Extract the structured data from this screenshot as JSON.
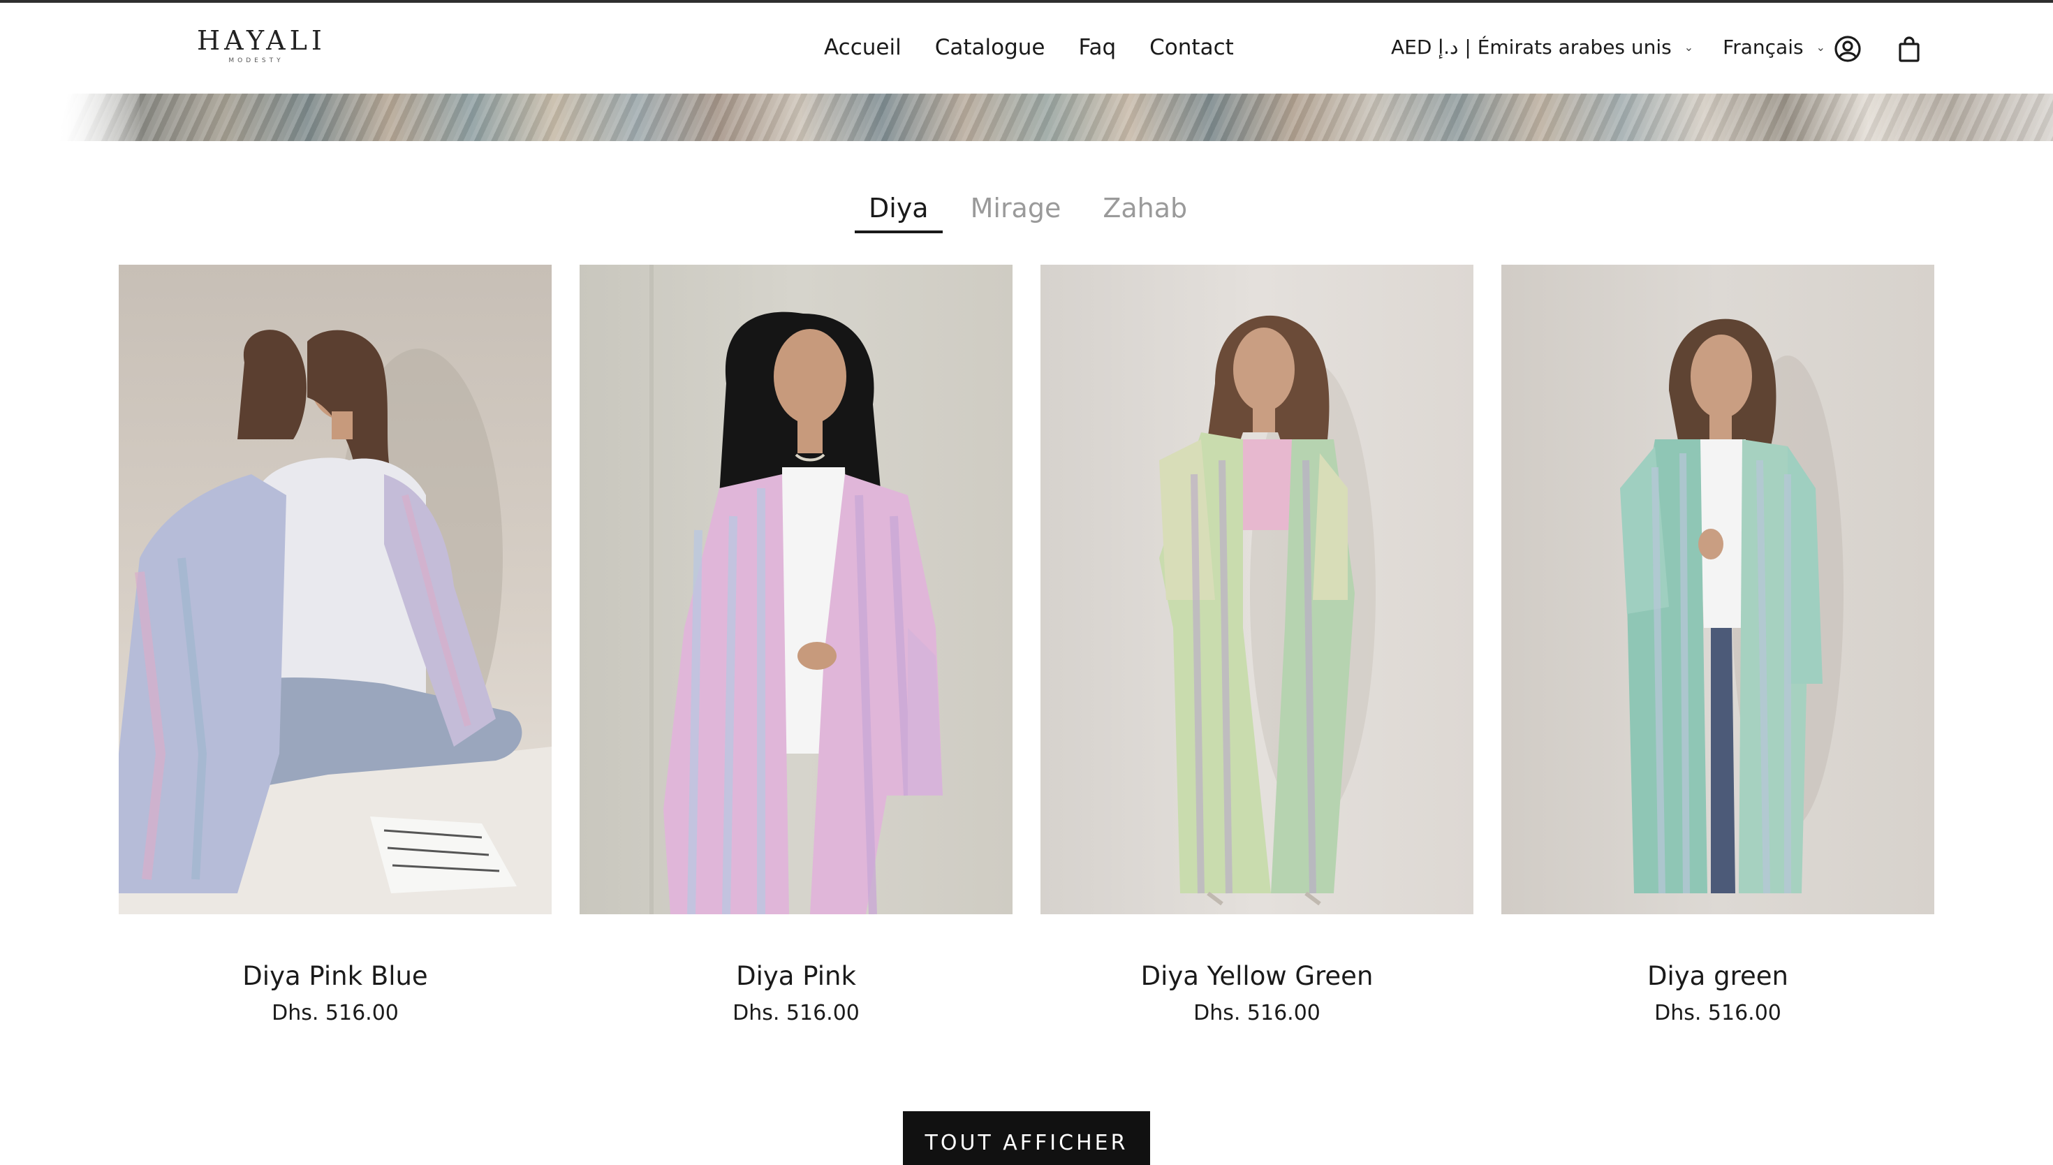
{
  "header": {
    "logo_text": "HAYALI",
    "logo_sub": "MODESTY",
    "nav": [
      "Accueil",
      "Catalogue",
      "Faq",
      "Contact"
    ],
    "currency_selector": "AED د.إ | Émirats arabes unis",
    "language_selector": "Français",
    "account_icon": "account-icon",
    "cart_icon": "cart-icon"
  },
  "collection_tabs": {
    "items": [
      "Diya",
      "Mirage",
      "Zahab"
    ],
    "active": "Diya"
  },
  "products": [
    {
      "title": "Diya Pink Blue",
      "price": "Dhs. 516.00",
      "robe_colors": [
        "#b6bcd8",
        "#d9aecb",
        "#9fb6cf"
      ]
    },
    {
      "title": "Diya Pink",
      "price": "Dhs. 516.00",
      "robe_colors": [
        "#e0b6d9",
        "#c9a9d6",
        "#b9c7e0"
      ]
    },
    {
      "title": "Diya Yellow Green",
      "price": "Dhs. 516.00",
      "robe_colors": [
        "#c9dcae",
        "#b6d3b0",
        "#d8ddb8"
      ]
    },
    {
      "title": "Diya green",
      "price": "Dhs. 516.00",
      "robe_colors": [
        "#8fc6b5",
        "#a6d1c0",
        "#b8c6d8"
      ]
    }
  ],
  "view_all_button": "TOUT AFFICHER",
  "colors": {
    "text": "#1a1a1a",
    "muted_tab": "#9a9a9a",
    "button_bg": "#111111",
    "button_text": "#ffffff"
  }
}
